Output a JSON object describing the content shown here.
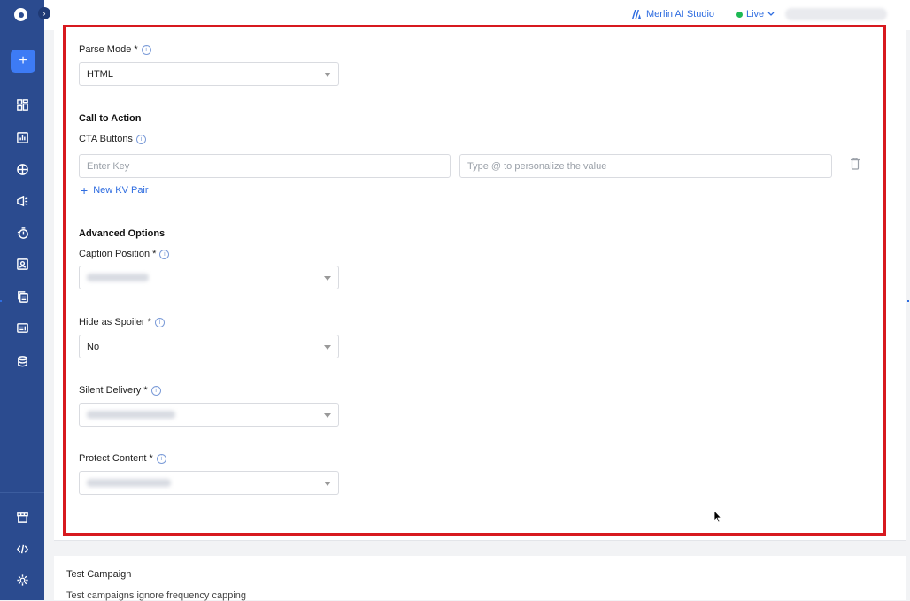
{
  "topbar": {
    "studio_label": "Merlin AI Studio",
    "env_label": "Live",
    "env_status_color": "#1db954"
  },
  "sidebar": {
    "add_label": "+",
    "icons": [
      "dashboard-icon",
      "analytics-icon",
      "segments-icon",
      "campaigns-icon",
      "journeys-icon",
      "personalization-icon",
      "templates-icon",
      "catalog-icon",
      "data-icon",
      "store-icon",
      "developer-icon",
      "settings-icon"
    ]
  },
  "form": {
    "parse_mode": {
      "label": "Parse Mode *",
      "value": "HTML"
    },
    "cta_section": {
      "title": "Call to Action",
      "buttons_label": "CTA Buttons",
      "key_placeholder": "Enter Key",
      "value_placeholder": "Type @ to personalize the value",
      "add_pair_label": "New KV Pair"
    },
    "advanced": {
      "title": "Advanced Options",
      "caption_position": {
        "label": "Caption Position *"
      },
      "hide_as_spoiler": {
        "label": "Hide as Spoiler *",
        "value": "No"
      },
      "silent_delivery": {
        "label": "Silent Delivery *"
      },
      "protect_content": {
        "label": "Protect Content *"
      }
    }
  },
  "test_campaign": {
    "title": "Test Campaign",
    "description": "Test campaigns ignore frequency capping"
  },
  "colors": {
    "sidebar_bg": "#2b4b8f",
    "accent": "#2f6de0",
    "highlight": "#d7191f"
  }
}
